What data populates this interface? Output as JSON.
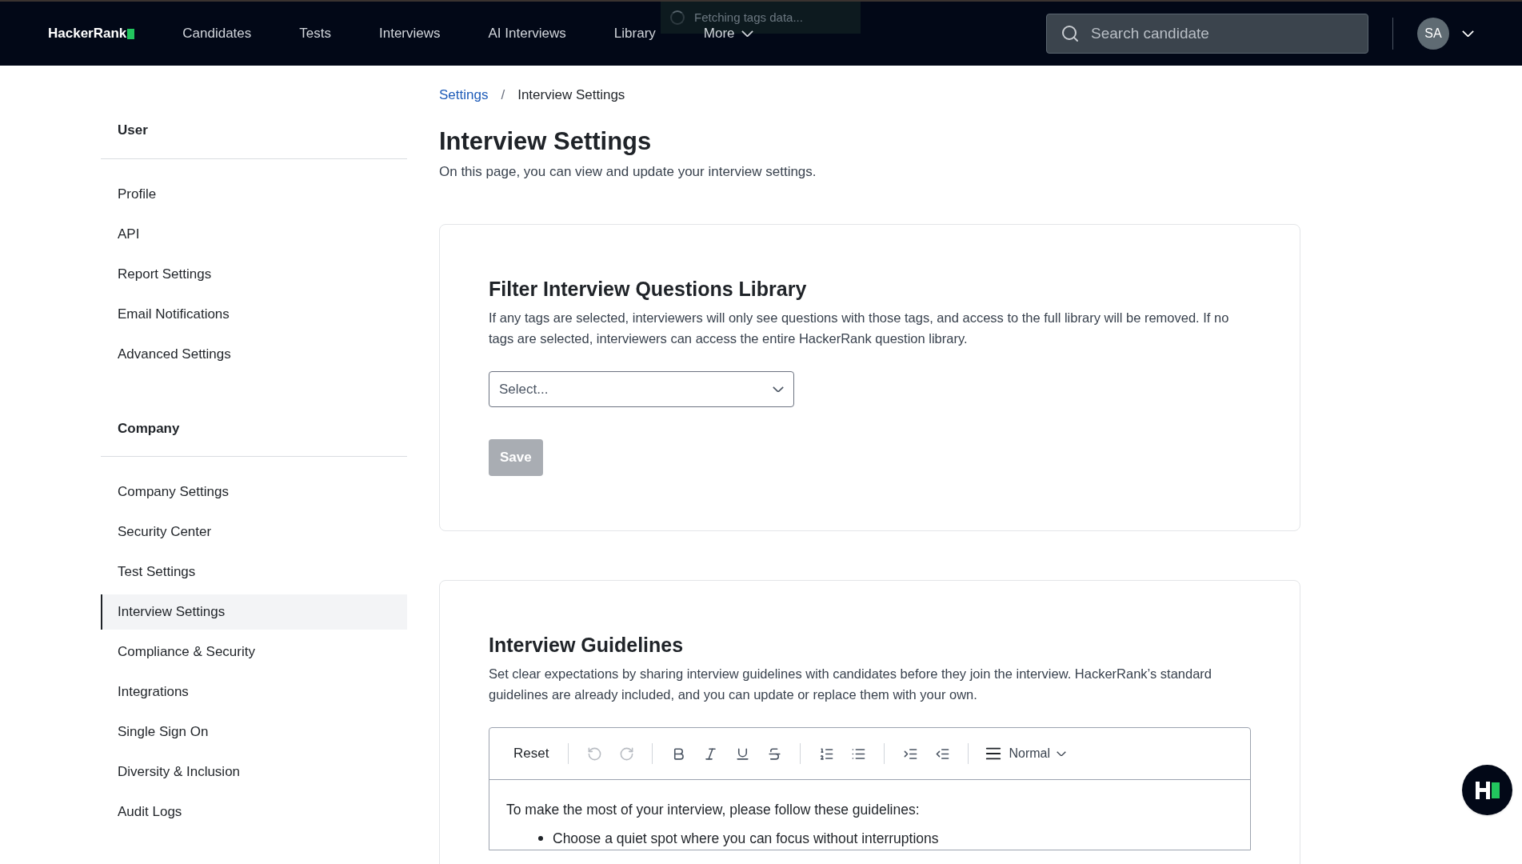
{
  "nav": {
    "logo": "HackerRank",
    "links": [
      "Candidates",
      "Tests",
      "Interviews",
      "AI Interviews",
      "Library",
      "More"
    ],
    "search": {
      "placeholder": "Search candidate"
    },
    "avatar": "SA"
  },
  "toast": {
    "text": "Fetching tags data..."
  },
  "sidebar": {
    "sections": [
      {
        "title": "User",
        "items": [
          {
            "label": "Profile",
            "selected": false
          },
          {
            "label": "API",
            "selected": false
          },
          {
            "label": "Report Settings",
            "selected": false
          },
          {
            "label": "Email Notifications",
            "selected": false
          },
          {
            "label": "Advanced Settings",
            "selected": false
          }
        ]
      },
      {
        "title": "Company",
        "items": [
          {
            "label": "Company Settings",
            "selected": false
          },
          {
            "label": "Security Center",
            "selected": false
          },
          {
            "label": "Test Settings",
            "selected": false
          },
          {
            "label": "Interview Settings",
            "selected": true
          },
          {
            "label": "Compliance & Security",
            "selected": false
          },
          {
            "label": "Integrations",
            "selected": false
          },
          {
            "label": "Single Sign On",
            "selected": false
          },
          {
            "label": "Diversity & Inclusion",
            "selected": false
          },
          {
            "label": "Audit Logs",
            "selected": false
          }
        ]
      }
    ]
  },
  "breadcrumb": [
    "Settings",
    "/",
    "Interview Settings"
  ],
  "page": {
    "title": "Interview Settings",
    "subtitle": "On this page, you can view and update your interview settings."
  },
  "filter_card": {
    "title": "Filter Interview Questions Library",
    "description": "If any tags are selected, interviewers will only see questions with those tags, and access to the full library will be removed. If no tags are selected, interviewers can access the entire HackerRank question library.",
    "select": {
      "placeholder": "Select..."
    },
    "save": {
      "label": "Save",
      "disabled": true
    }
  },
  "guidelines_card": {
    "title": "Interview Guidelines",
    "description": "Set clear expectations by sharing interview guidelines with candidates before they join the interview. HackerRank’s standard guidelines are already included, and you can update or replace them with your own.",
    "toolbar": {
      "reset": "Reset",
      "style": "Normal",
      "tools": [
        {
          "kind": "undo",
          "disabled": true
        },
        {
          "kind": "redo",
          "disabled": true
        },
        {
          "kind": "sep"
        },
        {
          "kind": "bold",
          "disabled": false
        },
        {
          "kind": "italic",
          "disabled": false
        },
        {
          "kind": "underline",
          "disabled": false
        },
        {
          "kind": "strike",
          "disabled": false
        },
        {
          "kind": "sep"
        },
        {
          "kind": "ordered",
          "disabled": false
        },
        {
          "kind": "bullets",
          "disabled": false
        },
        {
          "kind": "sep"
        },
        {
          "kind": "indent",
          "disabled": false
        },
        {
          "kind": "outdent",
          "disabled": false
        }
      ]
    },
    "editor": {
      "intro": "To make the most of your interview, please follow these guidelines:",
      "bullets": [
        "Choose a quiet spot where you can focus without interruptions"
      ]
    }
  }
}
